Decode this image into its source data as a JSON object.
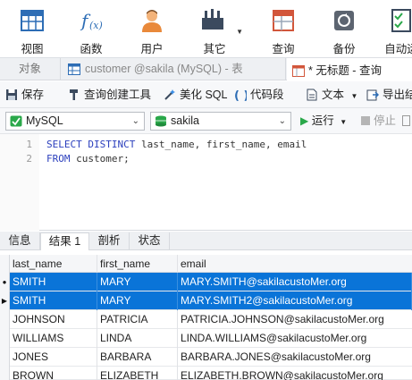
{
  "ribbon": {
    "buttons": [
      {
        "label": "视图",
        "icon": "table-view-icon"
      },
      {
        "label": "函数",
        "icon": "function-icon"
      },
      {
        "label": "用户",
        "icon": "user-icon"
      },
      {
        "label": "其它",
        "icon": "tools-icon"
      },
      {
        "label": "查询",
        "icon": "query-icon"
      },
      {
        "label": "备份",
        "icon": "backup-icon"
      },
      {
        "label": "自动运",
        "icon": "automation-icon"
      }
    ]
  },
  "tabs": {
    "objects": "对象",
    "customer": "customer @sakila (MySQL) - 表",
    "query": "* 无标题 - 查询"
  },
  "toolbar": {
    "save": "保存",
    "query_builder": "查询创建工具",
    "beautify": "美化 SQL",
    "code_snippet": "代码段",
    "text": "文本",
    "export": "导出结"
  },
  "connection": {
    "server": "MySQL",
    "database": "sakila",
    "run": "运行",
    "stop": "停止"
  },
  "editor": {
    "lines": [
      {
        "num": "1",
        "kw": "SELECT DISTINCT",
        "rest": " last_name, first_name, email"
      },
      {
        "num": "2",
        "kw": "FROM",
        "rest": " customer;"
      }
    ]
  },
  "result_tabs": [
    "信息",
    "结果 1",
    "剖析",
    "状态"
  ],
  "grid": {
    "columns": [
      "last_name",
      "first_name",
      "email"
    ],
    "rows": [
      [
        "SMITH",
        "MARY",
        "MARY.SMITH@sakilacustoMer.org"
      ],
      [
        "SMITH",
        "MARY",
        "MARY.SMITH2@sakilacustoMer.org"
      ],
      [
        "JOHNSON",
        "PATRICIA",
        "PATRICIA.JOHNSON@sakilacustoMer.org"
      ],
      [
        "WILLIAMS",
        "LINDA",
        "LINDA.WILLIAMS@sakilacustoMer.org"
      ],
      [
        "JONES",
        "BARBARA",
        "BARBARA.JONES@sakilacustoMer.org"
      ],
      [
        "BROWN",
        "ELIZABETH",
        "ELIZABETH.BROWN@sakilacustoMer.org"
      ]
    ]
  },
  "colors": {
    "selection": "#0a74d8",
    "keyword": "#2b3fbd",
    "run_green": "#2aa84a"
  }
}
